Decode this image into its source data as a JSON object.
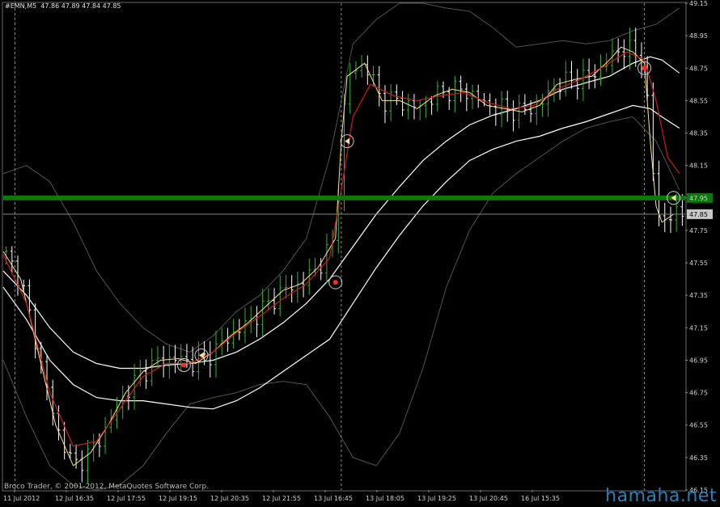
{
  "header": {
    "symbol": "#EMN,M5",
    "ohlc": "47.86 47.89 47.84 47.85"
  },
  "footer": {
    "copyright": "Broco Trader, © 2001-2012, MetaQuotes Software Corp.",
    "watermark": "hamaha.net"
  },
  "colors": {
    "background": "#000000",
    "candle_up": "#2fb52f",
    "candle_down": "#ffffff",
    "ma_fast": "#ffe680",
    "ma_red": "#d01a1a",
    "envelope": "#ffffff",
    "bollinger": "#4a5a4a",
    "level_line": "#0b7a0b",
    "price_line": "#8a8a8a",
    "signal_circle": "#c8c8c8",
    "signal_dot": "#ff2a2a"
  },
  "chart_data": {
    "type": "line",
    "title": "#EMN,M5",
    "timeframe": "M5",
    "ylim": [
      46.15,
      49.15
    ],
    "y_ticks": [
      "49.15",
      "48.95",
      "48.75",
      "48.55",
      "48.35",
      "48.15",
      "47.95",
      "47.75",
      "47.55",
      "47.35",
      "47.15",
      "46.95",
      "46.75",
      "46.55",
      "46.35",
      "46.15"
    ],
    "x_ticks": [
      "11 Jul 2012",
      "12 Jul 16:35",
      "12 Jul 17:55",
      "12 Jul 19:15",
      "12 Jul 20:35",
      "12 Jul 21:55",
      "13 Jul 16:45",
      "13 Jul 18:05",
      "13 Jul 19:25",
      "13 Jul 20:45",
      "16 Jul 15:35"
    ],
    "last_price": 47.85,
    "level_price": 47.95,
    "level_label": "47.95",
    "last_price_label": "47.85",
    "price_series": [
      {
        "x": 0,
        "y": 47.62
      },
      {
        "x": 3,
        "y": 47.45
      },
      {
        "x": 6,
        "y": 47.0
      },
      {
        "x": 9,
        "y": 46.55
      },
      {
        "x": 12,
        "y": 46.3
      },
      {
        "x": 15,
        "y": 46.38
      },
      {
        "x": 18,
        "y": 46.55
      },
      {
        "x": 21,
        "y": 46.75
      },
      {
        "x": 24,
        "y": 46.88
      },
      {
        "x": 27,
        "y": 46.95
      },
      {
        "x": 30,
        "y": 46.96
      },
      {
        "x": 33,
        "y": 46.93
      },
      {
        "x": 36,
        "y": 47.0
      },
      {
        "x": 39,
        "y": 47.1
      },
      {
        "x": 42,
        "y": 47.18
      },
      {
        "x": 45,
        "y": 47.28
      },
      {
        "x": 48,
        "y": 47.38
      },
      {
        "x": 51,
        "y": 47.42
      },
      {
        "x": 54,
        "y": 47.52
      },
      {
        "x": 57,
        "y": 47.7
      },
      {
        "x": 58,
        "y": 48.3
      },
      {
        "x": 59,
        "y": 48.7
      },
      {
        "x": 62,
        "y": 48.78
      },
      {
        "x": 65,
        "y": 48.55
      },
      {
        "x": 68,
        "y": 48.55
      },
      {
        "x": 71,
        "y": 48.5
      },
      {
        "x": 74,
        "y": 48.58
      },
      {
        "x": 77,
        "y": 48.62
      },
      {
        "x": 80,
        "y": 48.6
      },
      {
        "x": 83,
        "y": 48.52
      },
      {
        "x": 86,
        "y": 48.5
      },
      {
        "x": 89,
        "y": 48.48
      },
      {
        "x": 92,
        "y": 48.52
      },
      {
        "x": 95,
        "y": 48.65
      },
      {
        "x": 98,
        "y": 48.68
      },
      {
        "x": 101,
        "y": 48.7
      },
      {
        "x": 104,
        "y": 48.8
      },
      {
        "x": 106,
        "y": 48.88
      },
      {
        "x": 108,
        "y": 48.85
      },
      {
        "x": 110,
        "y": 48.78
      },
      {
        "x": 111,
        "y": 48.3
      },
      {
        "x": 112,
        "y": 47.9
      },
      {
        "x": 113,
        "y": 47.8
      },
      {
        "x": 115,
        "y": 47.85
      }
    ],
    "ma_red": [
      {
        "x": 0,
        "y": 47.6
      },
      {
        "x": 4,
        "y": 47.3
      },
      {
        "x": 8,
        "y": 46.75
      },
      {
        "x": 12,
        "y": 46.42
      },
      {
        "x": 16,
        "y": 46.45
      },
      {
        "x": 20,
        "y": 46.65
      },
      {
        "x": 24,
        "y": 46.85
      },
      {
        "x": 28,
        "y": 46.93
      },
      {
        "x": 32,
        "y": 46.93
      },
      {
        "x": 36,
        "y": 47.0
      },
      {
        "x": 40,
        "y": 47.12
      },
      {
        "x": 44,
        "y": 47.22
      },
      {
        "x": 48,
        "y": 47.33
      },
      {
        "x": 52,
        "y": 47.42
      },
      {
        "x": 56,
        "y": 47.58
      },
      {
        "x": 58,
        "y": 48.0
      },
      {
        "x": 60,
        "y": 48.45
      },
      {
        "x": 63,
        "y": 48.65
      },
      {
        "x": 67,
        "y": 48.58
      },
      {
        "x": 71,
        "y": 48.55
      },
      {
        "x": 75,
        "y": 48.58
      },
      {
        "x": 79,
        "y": 48.6
      },
      {
        "x": 83,
        "y": 48.54
      },
      {
        "x": 87,
        "y": 48.5
      },
      {
        "x": 91,
        "y": 48.52
      },
      {
        "x": 95,
        "y": 48.62
      },
      {
        "x": 99,
        "y": 48.68
      },
      {
        "x": 103,
        "y": 48.76
      },
      {
        "x": 107,
        "y": 48.85
      },
      {
        "x": 110,
        "y": 48.8
      },
      {
        "x": 112,
        "y": 48.55
      },
      {
        "x": 114,
        "y": 48.2
      },
      {
        "x": 116,
        "y": 48.1
      }
    ],
    "envelope_upper": [
      {
        "x": 0,
        "y": 47.5
      },
      {
        "x": 4,
        "y": 47.35
      },
      {
        "x": 8,
        "y": 47.15
      },
      {
        "x": 12,
        "y": 47.0
      },
      {
        "x": 16,
        "y": 46.93
      },
      {
        "x": 20,
        "y": 46.9
      },
      {
        "x": 24,
        "y": 46.9
      },
      {
        "x": 28,
        "y": 46.92
      },
      {
        "x": 32,
        "y": 46.93
      },
      {
        "x": 36,
        "y": 46.95
      },
      {
        "x": 40,
        "y": 47.0
      },
      {
        "x": 44,
        "y": 47.08
      },
      {
        "x": 48,
        "y": 47.18
      },
      {
        "x": 52,
        "y": 47.3
      },
      {
        "x": 56,
        "y": 47.45
      },
      {
        "x": 60,
        "y": 47.65
      },
      {
        "x": 64,
        "y": 47.85
      },
      {
        "x": 68,
        "y": 48.02
      },
      {
        "x": 72,
        "y": 48.18
      },
      {
        "x": 76,
        "y": 48.3
      },
      {
        "x": 80,
        "y": 48.4
      },
      {
        "x": 84,
        "y": 48.46
      },
      {
        "x": 88,
        "y": 48.5
      },
      {
        "x": 92,
        "y": 48.55
      },
      {
        "x": 96,
        "y": 48.62
      },
      {
        "x": 100,
        "y": 48.66
      },
      {
        "x": 104,
        "y": 48.7
      },
      {
        "x": 108,
        "y": 48.78
      },
      {
        "x": 111,
        "y": 48.82
      },
      {
        "x": 113,
        "y": 48.8
      },
      {
        "x": 116,
        "y": 48.72
      }
    ],
    "envelope_lower": [
      {
        "x": 0,
        "y": 47.4
      },
      {
        "x": 4,
        "y": 47.2
      },
      {
        "x": 8,
        "y": 46.95
      },
      {
        "x": 12,
        "y": 46.8
      },
      {
        "x": 16,
        "y": 46.72
      },
      {
        "x": 20,
        "y": 46.7
      },
      {
        "x": 24,
        "y": 46.7
      },
      {
        "x": 28,
        "y": 46.68
      },
      {
        "x": 32,
        "y": 46.66
      },
      {
        "x": 36,
        "y": 46.65
      },
      {
        "x": 40,
        "y": 46.7
      },
      {
        "x": 44,
        "y": 46.78
      },
      {
        "x": 48,
        "y": 46.88
      },
      {
        "x": 52,
        "y": 46.98
      },
      {
        "x": 56,
        "y": 47.08
      },
      {
        "x": 60,
        "y": 47.3
      },
      {
        "x": 64,
        "y": 47.52
      },
      {
        "x": 68,
        "y": 47.72
      },
      {
        "x": 72,
        "y": 47.9
      },
      {
        "x": 76,
        "y": 48.05
      },
      {
        "x": 80,
        "y": 48.18
      },
      {
        "x": 84,
        "y": 48.25
      },
      {
        "x": 88,
        "y": 48.3
      },
      {
        "x": 92,
        "y": 48.33
      },
      {
        "x": 96,
        "y": 48.38
      },
      {
        "x": 100,
        "y": 48.42
      },
      {
        "x": 104,
        "y": 48.47
      },
      {
        "x": 108,
        "y": 48.52
      },
      {
        "x": 111,
        "y": 48.5
      },
      {
        "x": 113,
        "y": 48.45
      },
      {
        "x": 116,
        "y": 48.38
      }
    ],
    "bollinger_upper": [
      {
        "x": 0,
        "y": 48.1
      },
      {
        "x": 4,
        "y": 48.15
      },
      {
        "x": 8,
        "y": 48.05
      },
      {
        "x": 12,
        "y": 47.8
      },
      {
        "x": 16,
        "y": 47.5
      },
      {
        "x": 20,
        "y": 47.3
      },
      {
        "x": 24,
        "y": 47.15
      },
      {
        "x": 28,
        "y": 47.05
      },
      {
        "x": 32,
        "y": 47.0
      },
      {
        "x": 36,
        "y": 47.1
      },
      {
        "x": 40,
        "y": 47.25
      },
      {
        "x": 44,
        "y": 47.35
      },
      {
        "x": 48,
        "y": 47.5
      },
      {
        "x": 52,
        "y": 47.7
      },
      {
        "x": 56,
        "y": 48.2
      },
      {
        "x": 60,
        "y": 48.9
      },
      {
        "x": 64,
        "y": 49.05
      },
      {
        "x": 68,
        "y": 49.15
      },
      {
        "x": 72,
        "y": 49.15
      },
      {
        "x": 76,
        "y": 49.12
      },
      {
        "x": 80,
        "y": 49.1
      },
      {
        "x": 84,
        "y": 49.0
      },
      {
        "x": 88,
        "y": 48.88
      },
      {
        "x": 92,
        "y": 48.9
      },
      {
        "x": 96,
        "y": 48.92
      },
      {
        "x": 100,
        "y": 48.9
      },
      {
        "x": 104,
        "y": 48.92
      },
      {
        "x": 108,
        "y": 48.98
      },
      {
        "x": 112,
        "y": 49.02
      },
      {
        "x": 116,
        "y": 49.12
      }
    ],
    "bollinger_lower": [
      {
        "x": 0,
        "y": 46.95
      },
      {
        "x": 4,
        "y": 46.6
      },
      {
        "x": 8,
        "y": 46.3
      },
      {
        "x": 12,
        "y": 46.18
      },
      {
        "x": 16,
        "y": 46.15
      },
      {
        "x": 20,
        "y": 46.18
      },
      {
        "x": 24,
        "y": 46.3
      },
      {
        "x": 28,
        "y": 46.5
      },
      {
        "x": 32,
        "y": 46.68
      },
      {
        "x": 36,
        "y": 46.72
      },
      {
        "x": 40,
        "y": 46.75
      },
      {
        "x": 44,
        "y": 46.8
      },
      {
        "x": 48,
        "y": 46.82
      },
      {
        "x": 52,
        "y": 46.8
      },
      {
        "x": 56,
        "y": 46.6
      },
      {
        "x": 60,
        "y": 46.35
      },
      {
        "x": 64,
        "y": 46.3
      },
      {
        "x": 68,
        "y": 46.5
      },
      {
        "x": 72,
        "y": 46.9
      },
      {
        "x": 76,
        "y": 47.4
      },
      {
        "x": 80,
        "y": 47.75
      },
      {
        "x": 84,
        "y": 47.98
      },
      {
        "x": 88,
        "y": 48.1
      },
      {
        "x": 92,
        "y": 48.2
      },
      {
        "x": 96,
        "y": 48.3
      },
      {
        "x": 100,
        "y": 48.38
      },
      {
        "x": 104,
        "y": 48.42
      },
      {
        "x": 108,
        "y": 48.45
      },
      {
        "x": 112,
        "y": 48.3
      },
      {
        "x": 116,
        "y": 48.0
      }
    ],
    "signals": [
      {
        "x": 31,
        "y": 46.92,
        "kind": "dot"
      },
      {
        "x": 34,
        "y": 46.98,
        "kind": "arrow"
      },
      {
        "x": 57,
        "y": 47.43,
        "kind": "dot"
      },
      {
        "x": 59,
        "y": 48.3,
        "kind": "arrow"
      },
      {
        "x": 110,
        "y": 48.75,
        "kind": "dot"
      },
      {
        "x": 115,
        "y": 47.95,
        "kind": "arrow"
      }
    ],
    "session_separators": [
      2,
      58,
      110
    ]
  }
}
